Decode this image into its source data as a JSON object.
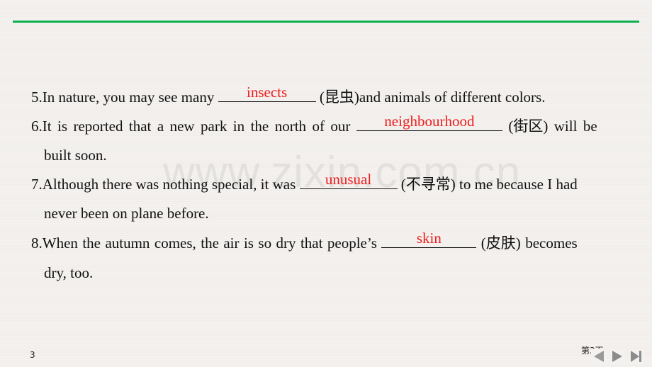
{
  "watermark": "www.zixin.com.cn",
  "questions": [
    {
      "number": "5.",
      "before": "In nature, you may see many ",
      "answer": "insects",
      "after": " (昆虫)and animals of different colors.",
      "continuation": ""
    },
    {
      "number": "6.",
      "before": "It is reported that a new park in the north of our ",
      "answer": "neighbourhood",
      "after": " (街区) will be",
      "continuation": "built soon."
    },
    {
      "number": "7.",
      "before": "Although there was nothing special, it was ",
      "answer": "unusual",
      "after": " (不寻常) to me because I had",
      "continuation": "never been on plane before."
    },
    {
      "number": "8.",
      "before": "When the autumn comes, the air is so dry that people’s ",
      "answer": "skin",
      "after": " (皮肤) becomes",
      "continuation": "dry, too."
    }
  ],
  "footer": {
    "slide_number": "3",
    "page_label": "第3页"
  },
  "colors": {
    "accent_rule": "#0eb050",
    "answer": "#ee1c1c"
  },
  "nav": {
    "prev_icon": "triangle-left-icon",
    "next_icon": "triangle-right-icon",
    "last_icon": "skip-end-icon"
  }
}
